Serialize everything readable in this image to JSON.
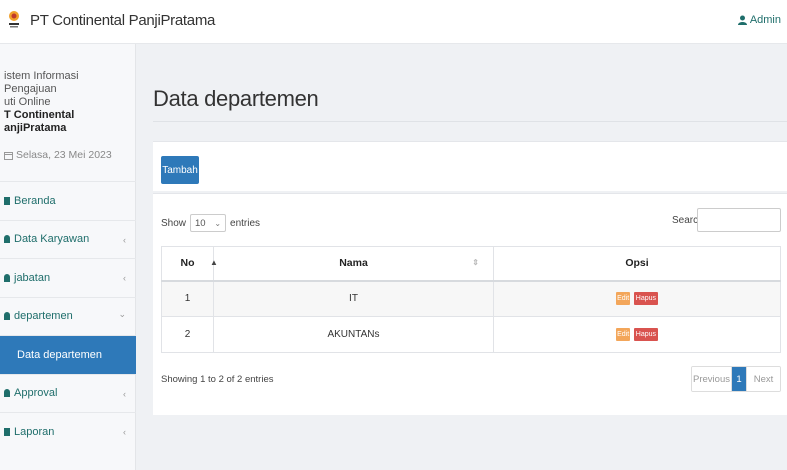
{
  "header": {
    "brand": "PT Continental PanjiPratama",
    "user": "Admin"
  },
  "sidebar": {
    "info_lines": [
      "istem Informasi Pengajuan",
      "uti Online"
    ],
    "company_lines": [
      "T Continental",
      "anjiPratama"
    ],
    "date": "Selasa, 23 Mei 2023",
    "items": [
      {
        "label": "Beranda",
        "chevron": ""
      },
      {
        "label": "Data Karyawan",
        "chevron": "‹"
      },
      {
        "label": "jabatan",
        "chevron": "‹"
      },
      {
        "label": "departemen",
        "chevron": "⌄"
      },
      {
        "label": "Data departemen",
        "chevron": ""
      },
      {
        "label": "Approval",
        "chevron": "‹"
      },
      {
        "label": "Laporan",
        "chevron": "‹"
      }
    ]
  },
  "main": {
    "title": "Data departemen",
    "add_button": "Tambah",
    "length": {
      "show": "Show",
      "value": "10",
      "entries": "entries"
    },
    "search_label": "Search:",
    "columns": [
      "No",
      "Nama",
      "Opsi"
    ],
    "rows": [
      {
        "no": "1",
        "nama": "IT"
      },
      {
        "no": "2",
        "nama": "AKUNTANs"
      }
    ],
    "edit_label": "Edit",
    "delete_label": "Hapus",
    "info": "Showing 1 to 2 of 2 entries",
    "pagination": {
      "prev": "Previous",
      "page": "1",
      "next": "Next"
    }
  },
  "colors": {
    "primary": "#2e79b9",
    "edit": "#f3a65a",
    "delete": "#d9534f",
    "menu_text": "#1f6e6b"
  }
}
